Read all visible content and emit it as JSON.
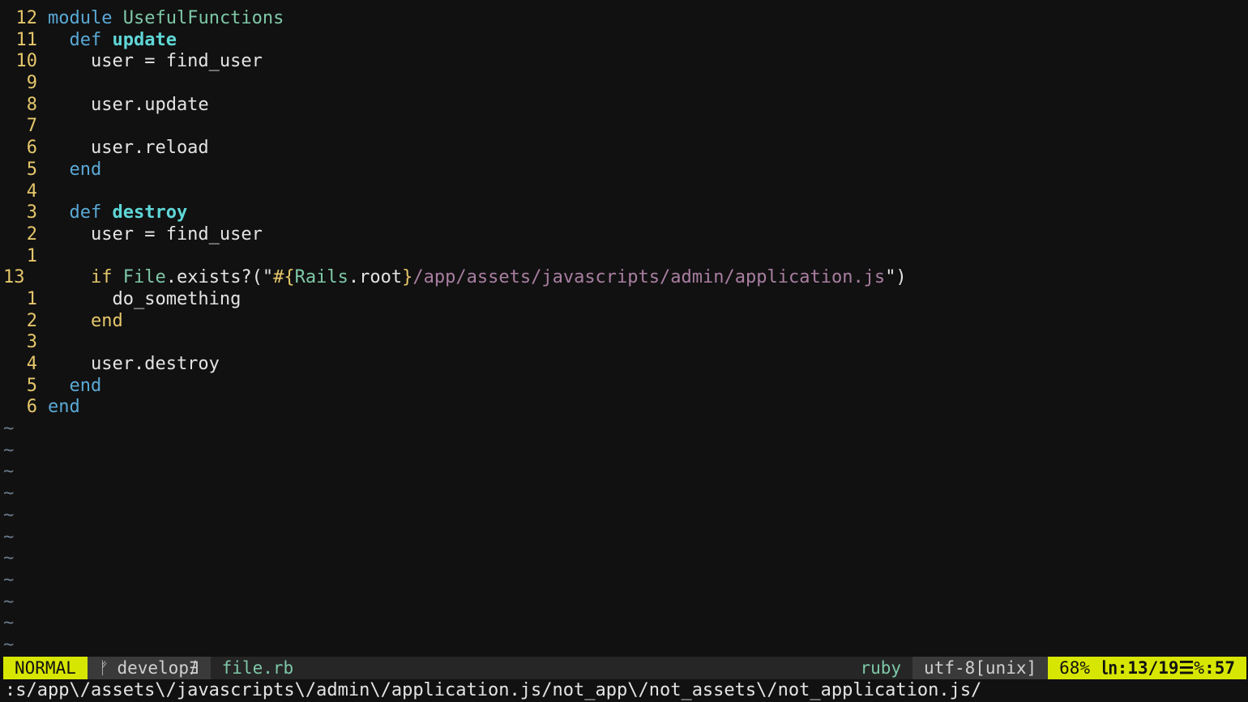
{
  "editor": {
    "lines": [
      {
        "num": "12",
        "current": false,
        "tokens": [
          {
            "t": "module",
            "c": "keyword"
          },
          {
            "t": " ",
            "c": "plain"
          },
          {
            "t": "UsefulFunctions",
            "c": "const"
          }
        ]
      },
      {
        "num": "11",
        "current": false,
        "tokens": [
          {
            "t": "  ",
            "c": "plain"
          },
          {
            "t": "def",
            "c": "keyword"
          },
          {
            "t": " ",
            "c": "plain"
          },
          {
            "t": "update",
            "c": "defname"
          }
        ]
      },
      {
        "num": "10",
        "current": false,
        "tokens": [
          {
            "t": "    user = find_user",
            "c": "plain"
          }
        ]
      },
      {
        "num": "9",
        "current": false,
        "tokens": []
      },
      {
        "num": "8",
        "current": false,
        "tokens": [
          {
            "t": "    user.update",
            "c": "plain"
          }
        ]
      },
      {
        "num": "7",
        "current": false,
        "tokens": []
      },
      {
        "num": "6",
        "current": false,
        "tokens": [
          {
            "t": "    user.reload",
            "c": "plain"
          }
        ]
      },
      {
        "num": "5",
        "current": false,
        "tokens": [
          {
            "t": "  ",
            "c": "plain"
          },
          {
            "t": "end",
            "c": "keyword"
          }
        ]
      },
      {
        "num": "4",
        "current": false,
        "tokens": []
      },
      {
        "num": "3",
        "current": false,
        "tokens": [
          {
            "t": "  ",
            "c": "plain"
          },
          {
            "t": "def",
            "c": "keyword"
          },
          {
            "t": " ",
            "c": "plain"
          },
          {
            "t": "destroy",
            "c": "defname"
          }
        ]
      },
      {
        "num": "2",
        "current": false,
        "tokens": [
          {
            "t": "    user = find_user",
            "c": "plain"
          }
        ]
      },
      {
        "num": "1",
        "current": false,
        "tokens": []
      },
      {
        "num": "13",
        "current": true,
        "tokens": [
          {
            "t": "    ",
            "c": "plain"
          },
          {
            "t": "if",
            "c": "keyword-ctrl"
          },
          {
            "t": " ",
            "c": "plain"
          },
          {
            "t": "File",
            "c": "const"
          },
          {
            "t": ".exists?(\"",
            "c": "plain"
          },
          {
            "t": "#{",
            "c": "interp"
          },
          {
            "t": "Rails",
            "c": "const"
          },
          {
            "t": ".root",
            "c": "plain"
          },
          {
            "t": "}",
            "c": "interp"
          },
          {
            "t": "/app/assets/javascripts/admin/application.js",
            "c": "string"
          },
          {
            "t": "\")",
            "c": "plain"
          }
        ]
      },
      {
        "num": "1",
        "current": false,
        "tokens": [
          {
            "t": "      do_something",
            "c": "plain"
          }
        ]
      },
      {
        "num": "2",
        "current": false,
        "tokens": [
          {
            "t": "    ",
            "c": "plain"
          },
          {
            "t": "end",
            "c": "keyword-ctrl"
          }
        ]
      },
      {
        "num": "3",
        "current": false,
        "tokens": []
      },
      {
        "num": "4",
        "current": false,
        "tokens": [
          {
            "t": "    user.destroy",
            "c": "plain"
          }
        ]
      },
      {
        "num": "5",
        "current": false,
        "tokens": [
          {
            "t": "  ",
            "c": "plain"
          },
          {
            "t": "end",
            "c": "keyword"
          }
        ]
      },
      {
        "num": "6",
        "current": false,
        "tokens": [
          {
            "t": "end",
            "c": "keyword"
          }
        ]
      }
    ],
    "tilde_char": "~",
    "tilde_count": 11
  },
  "statusbar": {
    "mode": "NORMAL",
    "branch_icon": "git-branch-icon",
    "branch_icon_glyph": "ᚠ",
    "branch": "develop",
    "dirty_glyph": "∄",
    "filename": "file.rb",
    "filetype": "ruby",
    "encoding": "utf-8[unix]",
    "percent": "68%",
    "ln_symbol": "㏑",
    "line_pos": ":13/19",
    "col_symbol": "☰",
    "col_sep": "%",
    "col_pos": ":57"
  },
  "cmdline": {
    "text": ":s/app\\/assets\\/javascripts\\/admin\\/application.js/not_app\\/not_assets\\/not_application.js/"
  },
  "colors": {
    "background": "#111111",
    "line_number": "#e6c76b",
    "keyword": "#5aa9d6",
    "constant": "#7ec8a8",
    "def_name": "#5fd7d7",
    "string": "#a97ea1",
    "mode_bg": "#d7e600"
  }
}
